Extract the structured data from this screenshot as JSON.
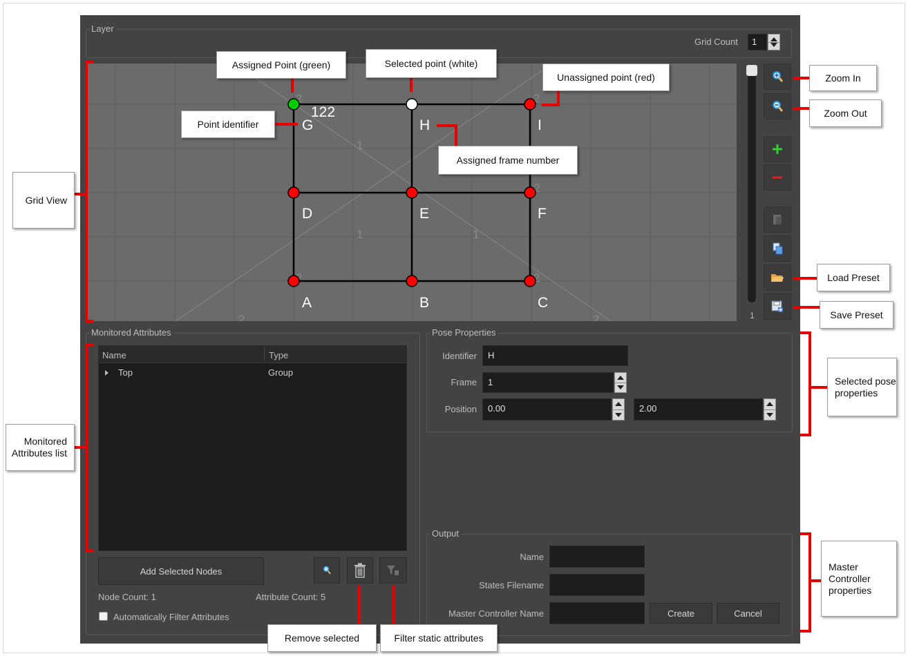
{
  "layer": {
    "title": "Layer",
    "grid_count_label": "Grid Count",
    "grid_count_value": "1"
  },
  "grid": {
    "points": [
      {
        "id": "G",
        "status": "assigned",
        "color": "#00cc00"
      },
      {
        "id": "H",
        "status": "selected",
        "color": "#ffffff"
      },
      {
        "id": "I",
        "status": "unassigned",
        "color": "#ff0000"
      },
      {
        "id": "D",
        "status": "unassigned",
        "color": "#ff0000"
      },
      {
        "id": "E",
        "status": "unassigned",
        "color": "#ff0000"
      },
      {
        "id": "F",
        "status": "unassigned",
        "color": "#ff0000"
      },
      {
        "id": "A",
        "status": "unassigned",
        "color": "#ff0000"
      },
      {
        "id": "B",
        "status": "unassigned",
        "color": "#ff0000"
      },
      {
        "id": "C",
        "status": "unassigned",
        "color": "#ff0000"
      }
    ],
    "assigned_frame_label": "122",
    "faint_numbers": [
      "2",
      "1",
      "2",
      "2",
      "1",
      "1",
      "2",
      "2",
      "2",
      "2"
    ],
    "zoom_slider_value": "1"
  },
  "toolbar": {
    "buttons": [
      {
        "name": "zoom-in-button",
        "icon": "zoom-in-icon"
      },
      {
        "name": "zoom-out-button",
        "icon": "zoom-out-icon"
      },
      {
        "name": "add-point-button",
        "icon": "plus-icon"
      },
      {
        "name": "remove-point-button",
        "icon": "minus-icon"
      },
      {
        "name": "paste-button",
        "icon": "paste-icon"
      },
      {
        "name": "copy-button",
        "icon": "copy-icon"
      },
      {
        "name": "load-preset-button",
        "icon": "folder-icon"
      },
      {
        "name": "save-preset-button",
        "icon": "save-icon"
      }
    ]
  },
  "monitored": {
    "title": "Monitored Attributes",
    "columns": [
      "Name",
      "Type"
    ],
    "rows": [
      {
        "name": "Top",
        "type": "Group"
      }
    ],
    "add_button": "Add Selected Nodes",
    "node_count": "Node Count: 1",
    "attribute_count": "Attribute Count: 5",
    "auto_filter_label": "Automatically Filter Attributes"
  },
  "pose": {
    "title": "Pose Properties",
    "identifier_label": "Identifier",
    "identifier_value": "H",
    "frame_label": "Frame",
    "frame_value": "1",
    "position_label": "Position",
    "position_x": "0.00",
    "position_y": "2.00"
  },
  "output": {
    "title": "Output",
    "name_label": "Name",
    "name_value": "",
    "states_label": "States Filename",
    "states_value": "",
    "master_label": "Master Controller Name",
    "master_value": "",
    "create_button": "Create",
    "cancel_button": "Cancel"
  },
  "callouts": {
    "grid_view": "Grid View",
    "assigned_point": "Assigned Point (green)",
    "selected_point": "Selected point (white)",
    "unassigned_point": "Unassigned point (red)",
    "point_identifier": "Point identifier",
    "assigned_frame": "Assigned frame number",
    "zoom_in": "Zoom In",
    "zoom_out": "Zoom Out",
    "load_preset": "Load Preset",
    "save_preset": "Save Preset",
    "selected_pose": "Selected pose properties",
    "monitored_list": "Monitored Attributes list",
    "master_controller": "Master Controller properties",
    "remove_selected": "Remove selected",
    "filter_static": "Filter static attributes"
  },
  "colors": {
    "accent_red": "#e60000",
    "panel_bg": "#434343",
    "grid_bg": "#6b6b6b",
    "field_bg": "#1c1c1c"
  }
}
